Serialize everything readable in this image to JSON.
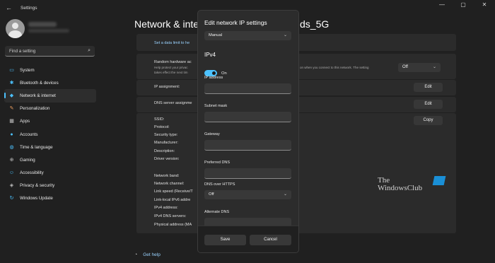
{
  "window": {
    "app_title": "Settings",
    "back_glyph": "←",
    "minimize_glyph": "—",
    "maximize_glyph": "▢",
    "close_glyph": "✕"
  },
  "sidebar": {
    "search_placeholder": "Find a setting",
    "search_icon": "⌕",
    "items": [
      {
        "label": "System",
        "icon": "system-icon",
        "glyph": "▭",
        "color": "#4cc2ff"
      },
      {
        "label": "Bluetooth & devices",
        "icon": "bluetooth-icon",
        "glyph": "✱",
        "color": "#4cc2ff"
      },
      {
        "label": "Network & internet",
        "icon": "network-icon",
        "glyph": "◆",
        "color": "#4cc2ff",
        "active": true
      },
      {
        "label": "Personalization",
        "icon": "brush-icon",
        "glyph": "✎",
        "color": "#f0a060"
      },
      {
        "label": "Apps",
        "icon": "apps-icon",
        "glyph": "▦",
        "color": "#c0c0c0"
      },
      {
        "label": "Accounts",
        "icon": "accounts-icon",
        "glyph": "●",
        "color": "#4cc2ff"
      },
      {
        "label": "Time & language",
        "icon": "globe-icon",
        "glyph": "◍",
        "color": "#4cc2ff"
      },
      {
        "label": "Gaming",
        "icon": "gaming-icon",
        "glyph": "⊕",
        "color": "#c0c0c0"
      },
      {
        "label": "Accessibility",
        "icon": "accessibility-icon",
        "glyph": "☺",
        "color": "#4cc2ff"
      },
      {
        "label": "Privacy & security",
        "icon": "shield-icon",
        "glyph": "◈",
        "color": "#c0c0c0"
      },
      {
        "label": "Windows Update",
        "icon": "update-icon",
        "glyph": "↻",
        "color": "#4cc2ff"
      }
    ]
  },
  "main": {
    "title_left": "Network & inte",
    "title_right": "ds_5G",
    "data_limit_link": "Set a data limit to he",
    "random_hw_title": "Random hardware ac",
    "random_hw_desc1": "Help protect your privac",
    "random_hw_desc2": "takes effect the next tim",
    "random_hw_desc_right": "on when you connect to this network. The setting",
    "random_hw_value": "Off",
    "ip_assignment_label": "IP assignment:",
    "ip_edit": "Edit",
    "dns_assignment_label": "DNS server assignme",
    "dns_edit": "Edit",
    "copy_button": "Copy",
    "properties": [
      "SSID:",
      "Protocol:",
      "Security type:",
      "Manufacturer:",
      "Description:",
      "Driver version:",
      "",
      "Network band:",
      "Network channel:",
      "Link speed (Receive/T",
      "Link-local IPv6 addre",
      "IPv4 address:",
      "IPv4 DNS servers:",
      "Physical address (MA"
    ],
    "get_help": "Get help"
  },
  "watermark": {
    "line1": "The",
    "line2": "WindowsClub"
  },
  "dialog": {
    "title": "Edit network IP settings",
    "mode_value": "Manual",
    "section": "IPv4",
    "toggle_label": "On",
    "ip_address_label": "IP address",
    "subnet_mask_label": "Subnet mask",
    "gateway_label": "Gateway",
    "preferred_dns_label": "Preferred DNS",
    "dns_over_https_label": "DNS over HTTPS",
    "dns_over_https_value": "Off",
    "alternate_dns_label": "Alternate DNS",
    "save_label": "Save",
    "cancel_label": "Cancel"
  }
}
